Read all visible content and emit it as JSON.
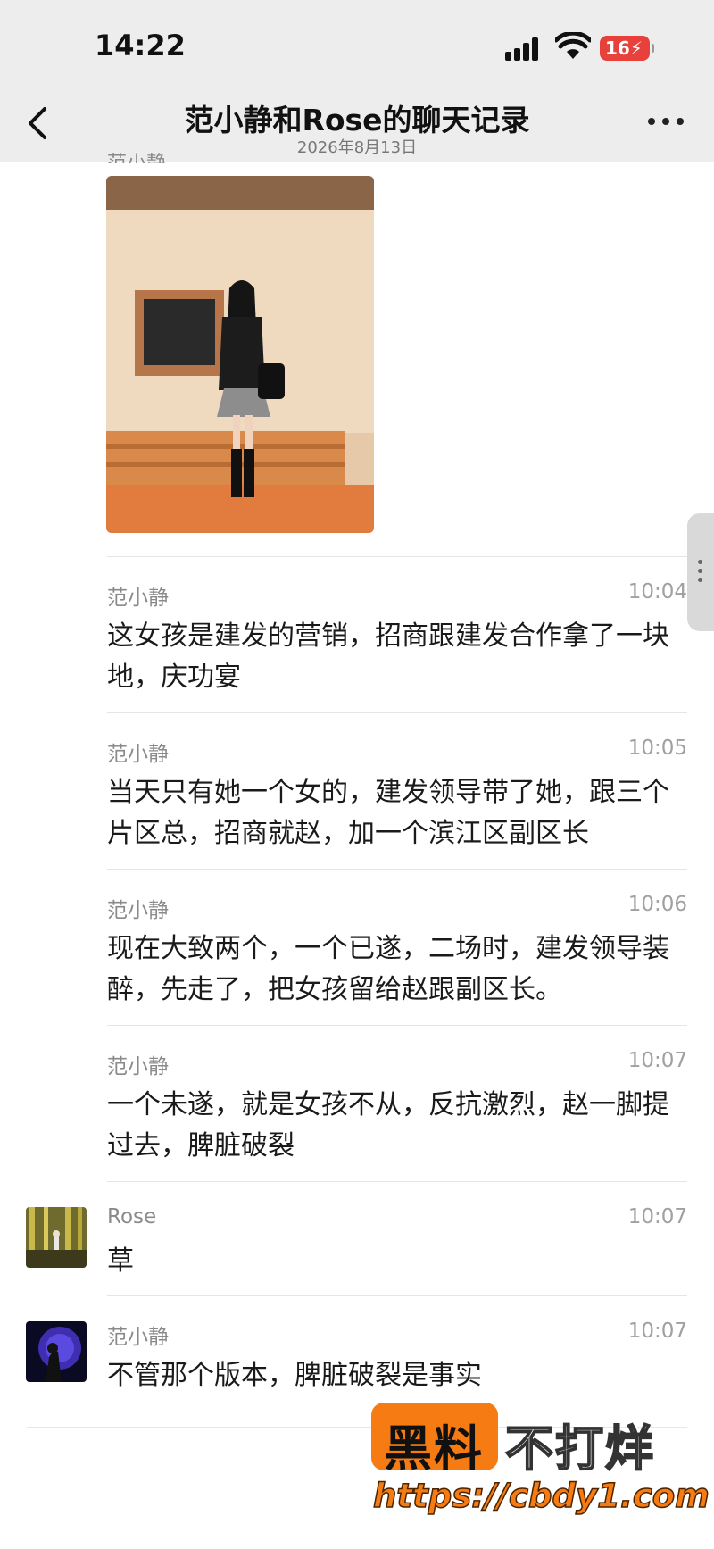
{
  "status_bar": {
    "time": "14:22",
    "battery": "16"
  },
  "nav": {
    "title": "范小静和Rose的聊天记录",
    "subtitle": "2026年8月13日"
  },
  "partial_sender": "范小静",
  "messages": [
    {
      "sender": "范小静",
      "time": "10:04",
      "text": "这女孩是建发的营销，招商跟建发合作拿了一块地，庆功宴"
    },
    {
      "sender": "范小静",
      "time": "10:05",
      "text": "当天只有她一个女的，建发领导带了她，跟三个片区总，招商就赵，加一个滨江区副区长"
    },
    {
      "sender": "范小静",
      "time": "10:06",
      "text": "现在大致两个，一个已遂，二场时，建发领导装醉，先走了，把女孩留给赵跟副区长。"
    },
    {
      "sender": "范小静",
      "time": "10:07",
      "text": "一个未遂，就是女孩不从，反抗激烈，赵一脚提过去，脾脏破裂"
    },
    {
      "sender": "Rose",
      "time": "10:07",
      "text": "草"
    },
    {
      "sender": "范小静",
      "time": "10:07",
      "text": "不管那个版本，脾脏破裂是事实"
    }
  ],
  "watermark": {
    "black_text": "黑料",
    "white_text": "不打烊",
    "url": "https://cbdy1.com"
  },
  "icons": [
    "back-chevron-icon",
    "more-dots-icon",
    "signal-icon",
    "wifi-icon",
    "battery-icon"
  ]
}
